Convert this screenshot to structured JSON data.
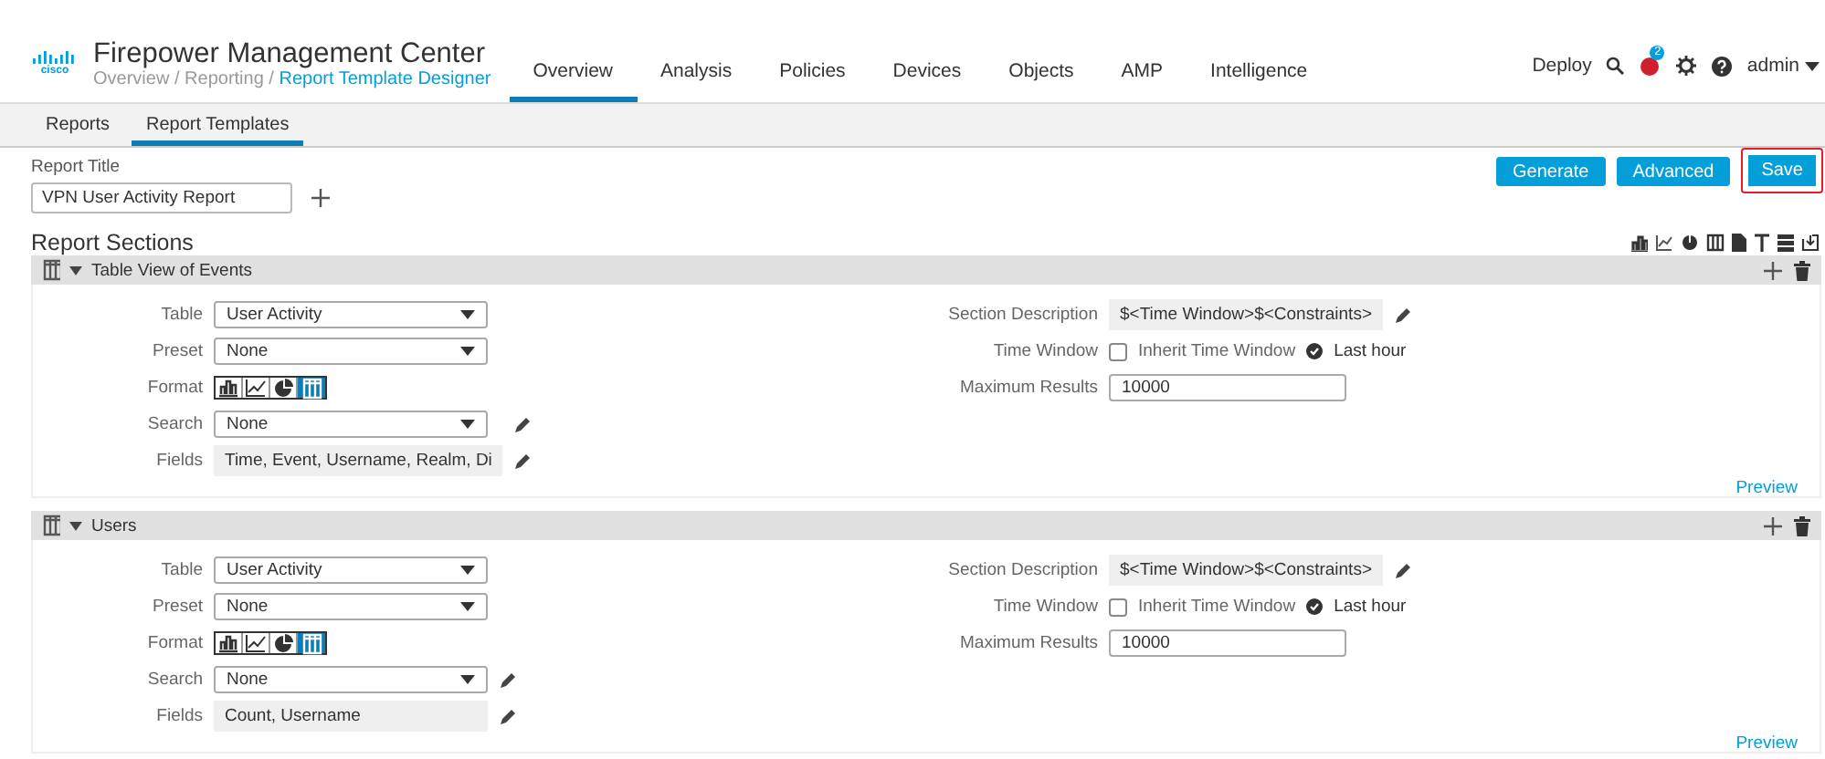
{
  "header": {
    "logo_text": "cisco",
    "title": "Firepower Management Center",
    "breadcrumb": [
      {
        "label": "Overview",
        "current": false
      },
      {
        "label": "Reporting",
        "current": false
      },
      {
        "label": "Report Template Designer",
        "current": true
      }
    ],
    "breadcrumb_separator": "/",
    "nav": [
      {
        "label": "Overview",
        "selected": true
      },
      {
        "label": "Analysis",
        "selected": false
      },
      {
        "label": "Policies",
        "selected": false
      },
      {
        "label": "Devices",
        "selected": false
      },
      {
        "label": "Objects",
        "selected": false
      },
      {
        "label": "AMP",
        "selected": false
      },
      {
        "label": "Intelligence",
        "selected": false
      }
    ],
    "deploy": "Deploy",
    "notification_count": "2",
    "user": "admin"
  },
  "subtabs": [
    {
      "label": "Reports",
      "selected": false
    },
    {
      "label": "Report Templates",
      "selected": true
    }
  ],
  "report_title": {
    "label": "Report Title",
    "value": "VPN User Activity Report"
  },
  "actions": [
    {
      "label": "Generate",
      "outlined": false
    },
    {
      "label": "Advanced",
      "outlined": false
    },
    {
      "label": "Save",
      "outlined": true
    }
  ],
  "sections_heading": "Report Sections",
  "sections": [
    {
      "title": "Table View of Events",
      "expanded": true,
      "table": {
        "label": "Table",
        "value": "User Activity"
      },
      "preset": {
        "label": "Preset",
        "value": "None"
      },
      "format": {
        "label": "Format",
        "options": [
          {
            "kind": "bar",
            "selected": false
          },
          {
            "kind": "line",
            "selected": false
          },
          {
            "kind": "pie",
            "selected": false
          },
          {
            "kind": "table",
            "selected": true
          }
        ]
      },
      "search": {
        "label": "Search",
        "value": "None"
      },
      "fields": {
        "label": "Fields",
        "value": "Time, Event, Username, Realm, Di"
      },
      "description": {
        "label": "Section Description",
        "value": "$<Time Window>$<Constraints>"
      },
      "time_window": {
        "label": "Time Window",
        "inherit_label": "Inherit Time Window",
        "inherit_checked": false,
        "value": "Last hour"
      },
      "max_results": {
        "label": "Maximum Results",
        "value": "10000"
      },
      "preview": "Preview"
    },
    {
      "title": "Users",
      "expanded": true,
      "table": {
        "label": "Table",
        "value": "User Activity"
      },
      "preset": {
        "label": "Preset",
        "value": "None"
      },
      "format": {
        "label": "Format",
        "options": [
          {
            "kind": "bar",
            "selected": false
          },
          {
            "kind": "line",
            "selected": false
          },
          {
            "kind": "pie",
            "selected": false
          },
          {
            "kind": "table",
            "selected": true
          }
        ]
      },
      "search": {
        "label": "Search",
        "value": "None"
      },
      "fields": {
        "label": "Fields",
        "value": "Count, Username"
      },
      "description": {
        "label": "Section Description",
        "value": "$<Time Window>$<Constraints>"
      },
      "time_window": {
        "label": "Time Window",
        "inherit_label": "Inherit Time Window",
        "inherit_checked": false,
        "value": "Last hour"
      },
      "max_results": {
        "label": "Maximum Results",
        "value": "10000"
      },
      "preview": "Preview"
    }
  ]
}
